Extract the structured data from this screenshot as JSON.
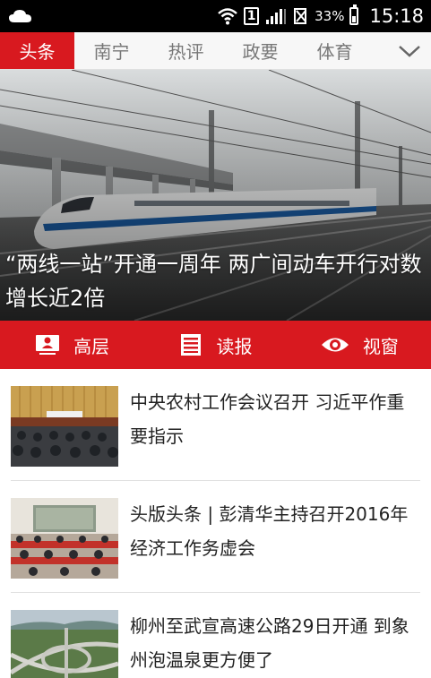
{
  "status_bar": {
    "battery_percent": "33%",
    "time": "15:18",
    "sim_label": "1"
  },
  "tabs": [
    {
      "label": "头条",
      "active": true
    },
    {
      "label": "南宁",
      "active": false
    },
    {
      "label": "热评",
      "active": false
    },
    {
      "label": "政要",
      "active": false
    },
    {
      "label": "体育",
      "active": false
    }
  ],
  "hero": {
    "caption": "“两线一站”开通一周年 两广间动车开行对数增长近2倍"
  },
  "shortcuts": [
    {
      "label": "高层",
      "icon": "person-card-icon"
    },
    {
      "label": "读报",
      "icon": "newspaper-icon"
    },
    {
      "label": "视窗",
      "icon": "eye-icon"
    }
  ],
  "news": [
    {
      "title": "中央农村工作会议召开 习近平作重要指示",
      "thumb": "meeting-hall-image"
    },
    {
      "title": "头版头条 | 彭清华主持召开2016年经济工作务虚会",
      "thumb": "conference-room-image"
    },
    {
      "title": "柳州至武宣高速公路29日开通 到象州泡温泉更方便了",
      "thumb": "highway-interchange-image"
    }
  ],
  "colors": {
    "brand_red": "#d8191f",
    "status_bar": "#000000"
  }
}
